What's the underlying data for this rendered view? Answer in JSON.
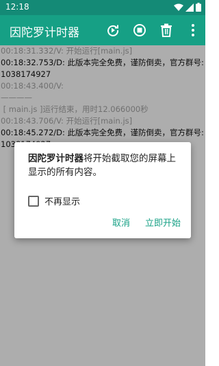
{
  "status_bar": {
    "time": "12:18"
  },
  "app_bar": {
    "title": "因陀罗计时器"
  },
  "log_lines": [
    {
      "text": "00:18:31.332/V: 开始运行[main.js]",
      "level": "v"
    },
    {
      "text": "00:18:32.753/D: 此版本完全免费，谨防倒卖，官方群号:1038174927",
      "level": "d"
    },
    {
      "text": "00:18:43.400/V:",
      "level": "v"
    },
    {
      "text": "————",
      "level": "v"
    },
    {
      "text": " [ main.js ]运行结束，用时12.066000秒",
      "level": "v"
    },
    {
      "text": "00:18:43.706/V: 开始运行[main.js]",
      "level": "v"
    },
    {
      "text": "00:18:45.272/D: 此版本完全免费，谨防倒卖，官方群号:1038174927",
      "level": "d"
    }
  ],
  "dialog": {
    "app_name": "因陀罗计时器",
    "message": "将开始截取您的屏幕上显示的所有内容。",
    "checkbox_label": "不再显示",
    "checkbox_checked": false,
    "cancel_label": "取消",
    "start_label": "立即开始"
  }
}
